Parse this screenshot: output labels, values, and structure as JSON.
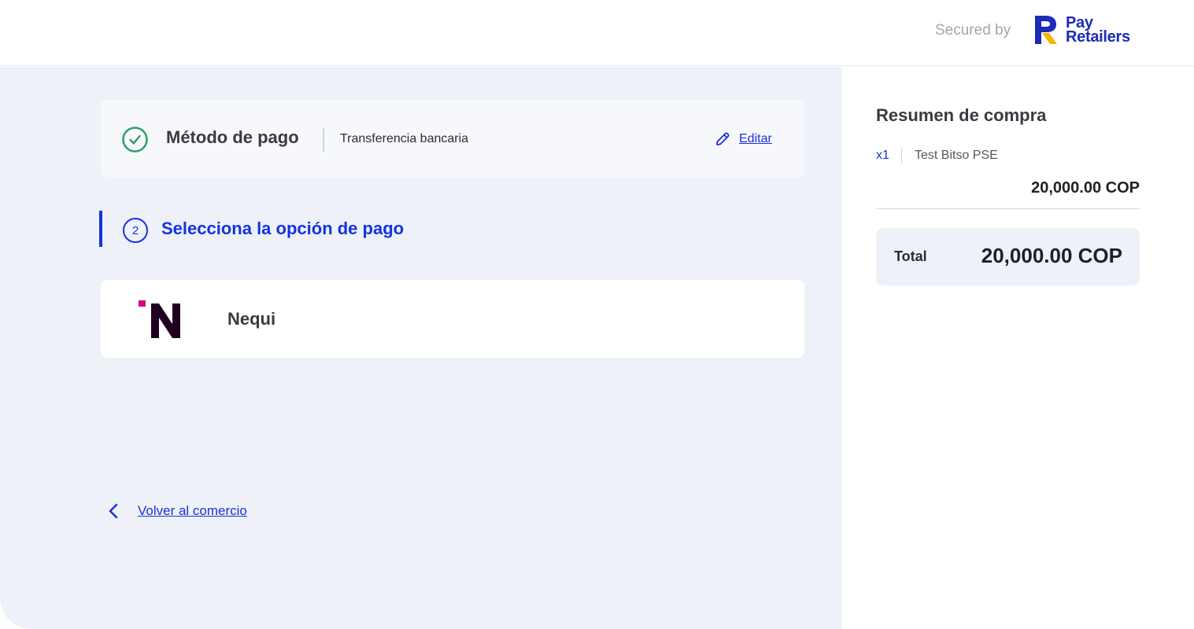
{
  "header": {
    "secured_by": "Secured by",
    "brand_line1": "Pay",
    "brand_line2": "Retailers",
    "brand_colors": {
      "primary": "#1c2bb8",
      "accent": "#f5b400"
    }
  },
  "method": {
    "title": "Método de pago",
    "value": "Transferencia bancaria",
    "edit_label": "Editar",
    "status_icon": "check-circle-icon",
    "edit_icon": "pencil-icon"
  },
  "step": {
    "number": "2",
    "title": "Selecciona la opción de pago"
  },
  "options": [
    {
      "label": "Nequi",
      "icon": "nequi-logo"
    }
  ],
  "back": {
    "label": "Volver al comercio",
    "icon": "chevron-left-icon"
  },
  "summary": {
    "title": "Resumen de compra",
    "qty": "x1",
    "item_name": "Test Bitso PSE",
    "item_price": "20,000.00 COP",
    "total_label": "Total",
    "total_value": "20,000.00 COP"
  },
  "colors": {
    "accent": "#1433e0",
    "success": "#2e9e6a",
    "background": "#eef1f8"
  }
}
